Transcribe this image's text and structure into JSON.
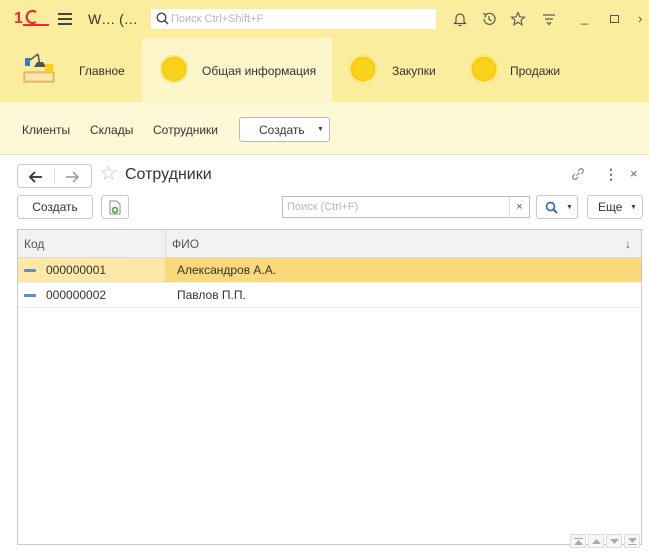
{
  "topbar": {
    "title": "W… (…",
    "search_placeholder": "Поиск Ctrl+Shift+F",
    "minimize": "_",
    "close": "×"
  },
  "sections": [
    {
      "label": "Главное",
      "icon": "desk-lamp-icon"
    },
    {
      "label": "Общая информация",
      "icon": "yellow-circle-icon"
    },
    {
      "label": "Закупки",
      "icon": "yellow-circle-icon"
    },
    {
      "label": "Продажи",
      "icon": "yellow-circle-icon"
    }
  ],
  "commands": {
    "links": [
      "Клиенты",
      "Склады",
      "Сотрудники"
    ],
    "create_label": "Создать"
  },
  "form": {
    "title": "Сотрудники",
    "create_label": "Создать",
    "search_placeholder": "Поиск (Ctrl+F)",
    "clear": "×",
    "more_label": "Еще",
    "more_glyph": "⋮",
    "close_glyph": "×"
  },
  "table": {
    "columns": [
      "Код",
      "ФИО"
    ],
    "sort_glyph": "↓",
    "rows": [
      {
        "code": "000000001",
        "name": "Александров А.А.",
        "selected": true
      },
      {
        "code": "000000002",
        "name": "Павлов П.П.",
        "selected": false
      }
    ]
  },
  "colors": {
    "accent_yellow": "#fbed9e",
    "selected_row": "#fbd87a",
    "logo_red": "#e62e2e"
  }
}
